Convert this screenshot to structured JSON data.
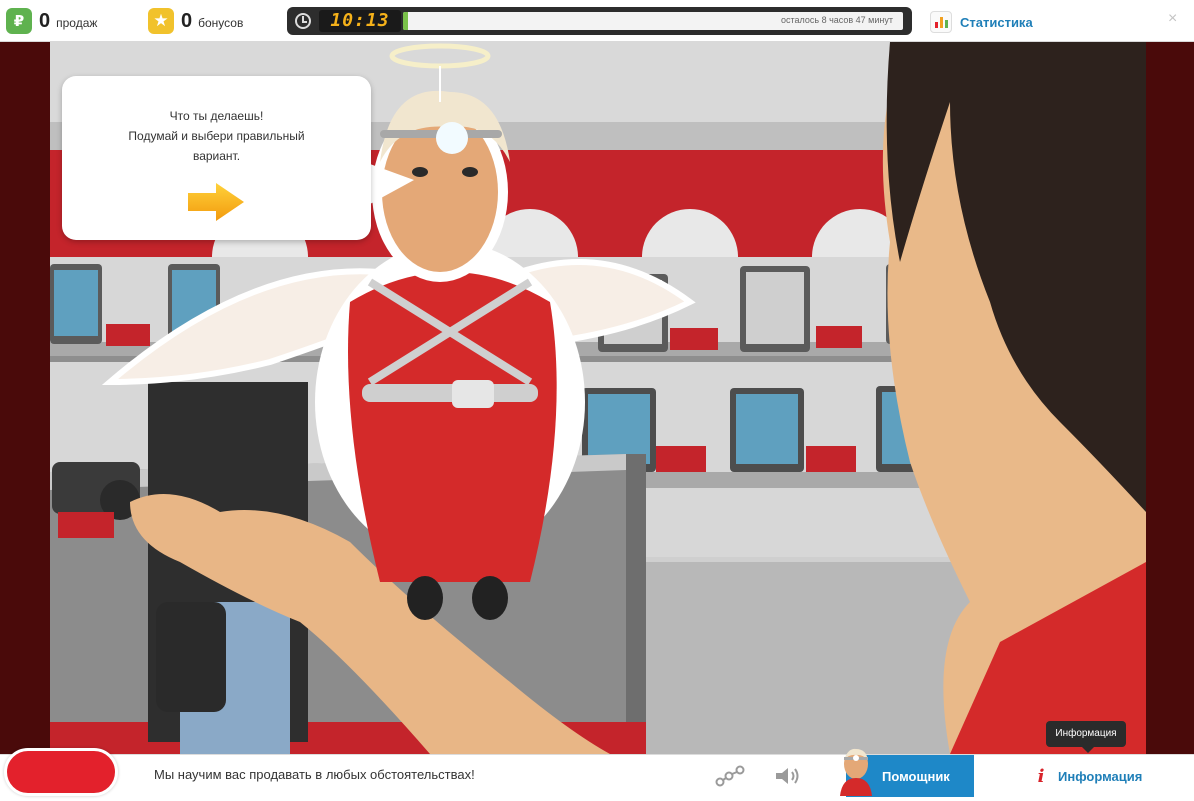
{
  "header": {
    "sales": {
      "icon": "ruble-icon",
      "glyph": "₽",
      "count": "0",
      "label": "продаж"
    },
    "bonuses": {
      "icon": "star-icon",
      "glyph": "★",
      "count": "0",
      "label": "бонусов"
    },
    "timer": {
      "time": "10:13",
      "remaining_text": "осталось 8 часов 47 минут",
      "progress_fraction": 0.01
    },
    "stats": {
      "icon": "bar-chart-icon",
      "label": "Статистика"
    },
    "close": {
      "icon": "close-icon",
      "glyph": "×"
    }
  },
  "scene": {
    "speech_bubble": {
      "line1": "Что ты делаешь!",
      "line2": "Подумай и выбери правильный",
      "line3": "вариант."
    },
    "next_arrow": {
      "icon": "arrow-right-icon"
    }
  },
  "footer": {
    "ticker": "Мы научим вас продавать в любых обстоятельствах!",
    "share_icon": "share-nodes-icon",
    "sound_icon": "speaker-icon",
    "helper": {
      "label": "Помощник",
      "icon": "angel-avatar-icon"
    },
    "info": {
      "glyph": "i",
      "label": "Информация",
      "tooltip": "Информация"
    }
  },
  "colors": {
    "accent_blue": "#1e88c8",
    "link_blue": "#1f7fb8",
    "green": "#5fb24f",
    "star_yellow": "#f1c22c",
    "timer_orange": "#f6b21a",
    "brand_red": "#e3212c"
  }
}
